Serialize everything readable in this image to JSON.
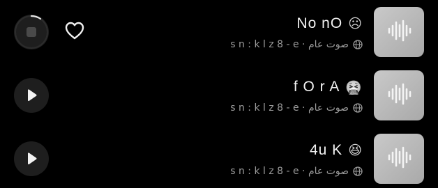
{
  "colors": {
    "background": "#000000",
    "title": "#f2f2f2",
    "meta": "#9a9a9a",
    "button_bg": "#1e1e1e",
    "cover": "#b8b8b8"
  },
  "sounds": [
    {
      "title": "No nO",
      "emoji": "☹",
      "meta": "صوت عام · s n : k l z 8 - e",
      "state": "playing",
      "button_icon": "stop-icon",
      "favorite_icon": "heart-outline-icon",
      "cover_icon": "waveform-icon"
    },
    {
      "title": "f O r A",
      "emoji": "🤮",
      "meta": "صوت عام · s n : k l z 8 - e",
      "state": "paused",
      "button_icon": "play-icon",
      "cover_icon": "waveform-icon"
    },
    {
      "title": "4u K",
      "emoji": "😆",
      "meta": "صوت عام · s n : k l z 8 - e",
      "state": "paused",
      "button_icon": "play-icon",
      "cover_icon": "waveform-icon"
    }
  ]
}
